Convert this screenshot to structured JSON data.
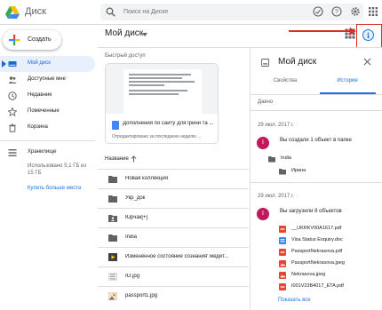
{
  "app": {
    "title": "Диск"
  },
  "search": {
    "placeholder": "Поиск на Диске"
  },
  "create": {
    "label": "Создать"
  },
  "sidebar": {
    "items": [
      {
        "label": "Мой диск",
        "icon": "drive-icon",
        "active": true
      },
      {
        "label": "Доступные мне",
        "icon": "shared-icon",
        "active": false
      },
      {
        "label": "Недавние",
        "icon": "clock-icon",
        "active": false
      },
      {
        "label": "Помеченные",
        "icon": "star-icon",
        "active": false
      },
      {
        "label": "Корзина",
        "icon": "trash-icon",
        "active": false
      }
    ],
    "storage": {
      "label": "Хранилище",
      "usage_line1": "Использовано 5,1 ГБ из",
      "usage_line2": "15 ГБ",
      "buy_more": "Купить больше места"
    }
  },
  "main": {
    "breadcrumb": "Мой диск",
    "quick_access": {
      "label": "Быстрый доступ",
      "card": {
        "title": "Дополнения по сайту для Ірини та ...",
        "subtitle": "Отредактировано за последнюю неделю ..."
      }
    },
    "files_header": "Название",
    "files": [
      {
        "name": "Новая коллекция",
        "type": "folder"
      },
      {
        "name": "Укр_док",
        "type": "folder"
      },
      {
        "name": "Юрчак[+]",
        "type": "shared-folder"
      },
      {
        "name": "India",
        "type": "folder"
      },
      {
        "name": "Измененное состояние сознания' медит...",
        "type": "video"
      },
      {
        "name": "IO.jpg",
        "type": "image"
      },
      {
        "name": "passport1.jpg",
        "type": "image"
      }
    ]
  },
  "details": {
    "title": "Мой диск",
    "tabs": [
      "Свойства",
      "История"
    ],
    "active_tab": "История",
    "period": "Давно",
    "activities": [
      {
        "date": "29 июл. 2017 г.",
        "avatar": "I",
        "actor": "Вы",
        "action": "создали 1 объект в папке",
        "items": [
          {
            "label": "India",
            "icon": "folder"
          },
          {
            "label": "Ирина",
            "icon": "folder"
          }
        ]
      },
      {
        "date": "29 июл. 2017 г.",
        "avatar": "I",
        "actor": "Вы",
        "action": "загрузили 8 объектов",
        "items": [
          {
            "label": "__UKRKV00A1617.pdf",
            "icon": "pdf"
          },
          {
            "label": "Visa Status Enquiry.doc",
            "icon": "doc"
          },
          {
            "label": "PassportNekrasova.pdf",
            "icon": "pdf"
          },
          {
            "label": "PassportNekrasova.jpeg",
            "icon": "image"
          },
          {
            "label": "Nekrasova.jpeg",
            "icon": "image"
          },
          {
            "label": "I001V23B4017_ETA.pdf",
            "icon": "pdf"
          }
        ],
        "show_all": "Показать все"
      }
    ]
  },
  "colors": {
    "accent": "#1a73e8",
    "highlight": "#d93025",
    "avatar": "#c2185b",
    "active_nav_bg": "#e8f0fe"
  }
}
